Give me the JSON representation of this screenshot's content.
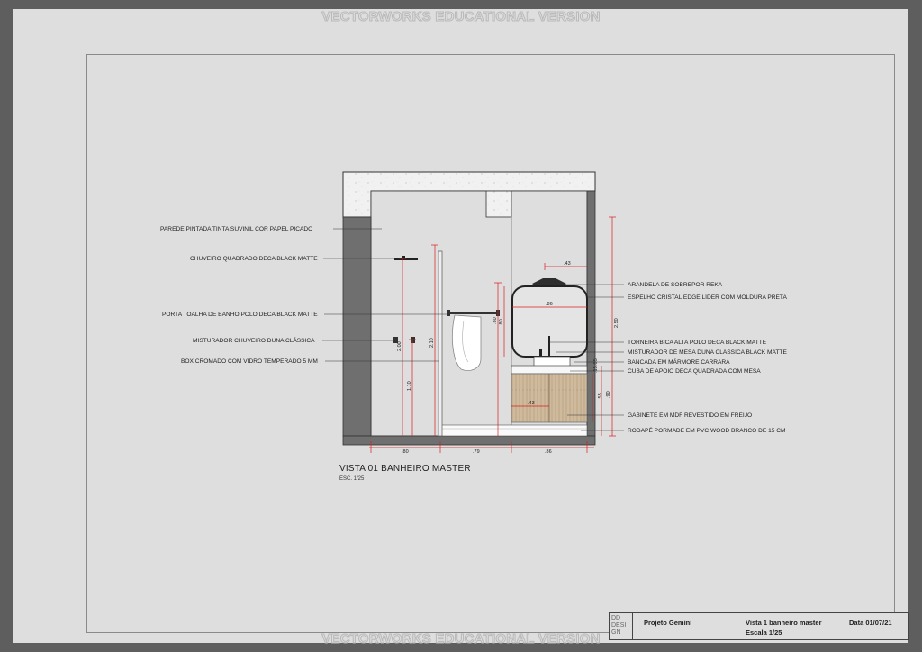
{
  "watermark": {
    "top": "VECTORWORKS EDUCATIONAL VERSION",
    "bottom": "VECTORWORKS EDUCATIONAL VERSION"
  },
  "view": {
    "title": "VISTA 01 BANHEIRO MASTER",
    "scale": "ESC. 1/25"
  },
  "labels_left": [
    "PAREDE PINTADA TINTA SUVINIL COR PAPEL PICADO",
    "CHUVEIRO QUADRADO DECA BLACK MATTE",
    "PORTA TOALHA DE BANHO POLO DECA BLACK MATTE",
    "MISTURADOR CHUVEIRO DUNA CLÁSSICA",
    "BOX CROMADO COM VIDRO TEMPERADO 5 MM"
  ],
  "labels_right": [
    "ARANDELA DE SOBREPOR REKA",
    "ESPELHO CRISTAL EDGE LÍDER COM MOLDURA PRETA",
    "TORNEIRA BICA ALTA POLO DECA BLACK MATTE",
    "MISTURADOR DE MESA DUNA CLÁSSICA BLACK MATTE",
    "BANCADA EM MÁRMORE CARRARA",
    "CUBA DE APOIO DECA QUADRADA COM MESA",
    "GABINETE EM MDF REVESTIDO EM FREIJÓ",
    "RODAPÉ PORMADE EM PVC WOOD BRANCO DE 15 CM"
  ],
  "dimensions": {
    "bottom": [
      ".80",
      ".79",
      ".86"
    ],
    "shower_height": "2.00",
    "mixer_height": "1.10",
    "box_height": "2.10",
    "towel_height": ".80",
    "wall_height": "2.50",
    "counter_height": ".90",
    "cabinet_height": ".55",
    "sconce_width": ".43",
    "mirror_width": ".86",
    "cabinet_width": ".43",
    "small_a": ".05",
    "small_b": ".15"
  },
  "titleblock": {
    "logo": [
      "DD",
      "DESI",
      "GN"
    ],
    "project": "Projeto Gemini",
    "sheet": "Vista 1 banheiro master",
    "scale": "Escala 1/25",
    "date": "Data 01/07/21"
  },
  "colors": {
    "dimension": "#d81e1e",
    "wall": "#6f6f6f",
    "concrete": "#f0f0f0",
    "wood": "#cdb79a",
    "leader": "#333333"
  }
}
